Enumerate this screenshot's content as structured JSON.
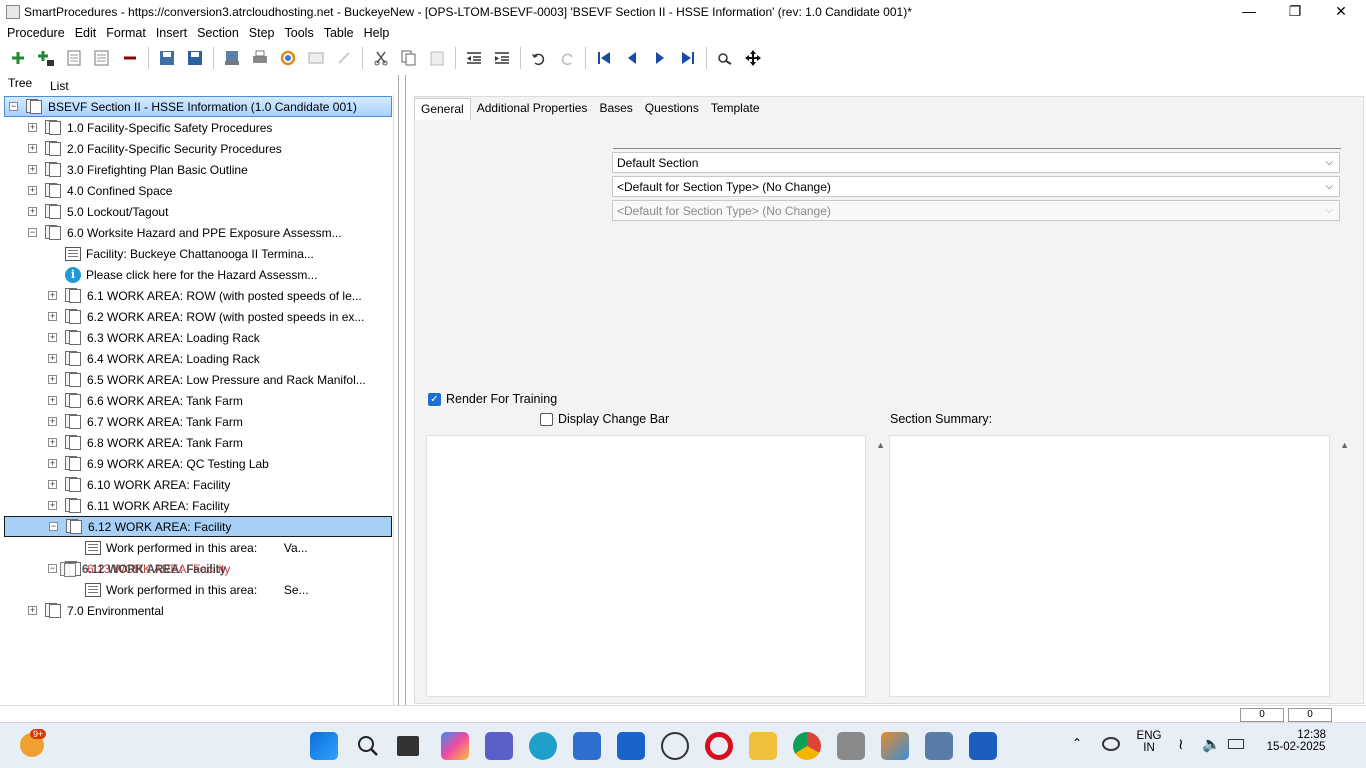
{
  "window": {
    "title": "SmartProcedures - https://conversion3.atrcloudhosting.net - BuckeyeNew - [OPS-LTOM-BSEVF-0003] 'BSEVF Section II - HSSE Information' (rev: 1.0 Candidate 001)*"
  },
  "menu": [
    "Procedure",
    "Edit",
    "Format",
    "Insert",
    "Section",
    "Step",
    "Tools",
    "Table",
    "Help"
  ],
  "toolbar_icons": [
    "add-icon",
    "add-child-icon",
    "section-icon",
    "section2-icon",
    "remove-icon",
    "save-copy-icon",
    "save-icon",
    "publish-icon",
    "print-icon",
    "refresh-icon",
    "pdf-icon",
    "disabled-icon",
    "cut-icon",
    "copy-icon",
    "paste-icon",
    "outdent-icon",
    "indent-icon",
    "undo-icon",
    "redo-icon",
    "first-icon",
    "prev-icon",
    "next-icon",
    "last-icon",
    "search-icon",
    "move-icon"
  ],
  "left_tabs": {
    "tree": "Tree",
    "list": "List"
  },
  "tree": [
    {
      "label": "BSEVF Section II - HSSE Information (1.0 Candidate 001)",
      "level": 0,
      "exp": "−",
      "icon": "section",
      "selected": true
    },
    {
      "label": "1.0 Facility-Specific Safety Procedures",
      "level": 1,
      "exp": "+",
      "icon": "section"
    },
    {
      "label": "2.0 Facility-Specific Security Procedures",
      "level": 1,
      "exp": "+",
      "icon": "section"
    },
    {
      "label": "3.0 Firefighting Plan Basic Outline",
      "level": 1,
      "exp": "+",
      "icon": "section"
    },
    {
      "label": "4.0 Confined Space",
      "level": 1,
      "exp": "+",
      "icon": "section"
    },
    {
      "label": "5.0 Lockout/Tagout",
      "level": 1,
      "exp": "+",
      "icon": "section"
    },
    {
      "label": "6.0 Worksite Hazard and PPE Exposure Assessm...",
      "level": 1,
      "exp": "−",
      "icon": "section"
    },
    {
      "label": "Facility: Buckeye Chattanooga II Termina...",
      "level": 2,
      "exp": "",
      "icon": "step"
    },
    {
      "label": "Please click here for the Hazard Assessm...",
      "level": 2,
      "exp": "",
      "icon": "info"
    },
    {
      "label": "6.1 WORK AREA: ROW (with posted speeds of le...",
      "level": 2,
      "exp": "+",
      "icon": "section"
    },
    {
      "label": "6.2 WORK AREA: ROW (with posted speeds in ex...",
      "level": 2,
      "exp": "+",
      "icon": "section"
    },
    {
      "label": "6.3 WORK AREA: Loading Rack",
      "level": 2,
      "exp": "+",
      "icon": "section"
    },
    {
      "label": "6.4 WORK AREA: Loading Rack",
      "level": 2,
      "exp": "+",
      "icon": "section"
    },
    {
      "label": "6.5 WORK AREA: Low Pressure and Rack Manifol...",
      "level": 2,
      "exp": "+",
      "icon": "section"
    },
    {
      "label": "6.6 WORK AREA: Tank Farm",
      "level": 2,
      "exp": "+",
      "icon": "section"
    },
    {
      "label": "6.7 WORK AREA: Tank Farm",
      "level": 2,
      "exp": "+",
      "icon": "section"
    },
    {
      "label": "6.8 WORK AREA: Tank Farm",
      "level": 2,
      "exp": "+",
      "icon": "section"
    },
    {
      "label": "6.9 WORK AREA: QC Testing Lab",
      "level": 2,
      "exp": "+",
      "icon": "section"
    },
    {
      "label": "6.10 WORK AREA: Facility",
      "level": 2,
      "exp": "+",
      "icon": "section"
    },
    {
      "label": "6.11 WORK AREA: Facility",
      "level": 2,
      "exp": "+",
      "icon": "section"
    },
    {
      "label": "6.12 WORK AREA: Facility",
      "level": 2,
      "exp": "−",
      "icon": "section",
      "selected2": true
    },
    {
      "label": "Work performed in this area:        Va...",
      "level": 3,
      "exp": "",
      "icon": "step"
    },
    {
      "label": "6.13 WORK AREA: Facility",
      "level": 2,
      "exp": "−",
      "icon": "section",
      "red": true
    },
    {
      "label": "Work performed in this area:        Se...",
      "level": 3,
      "exp": "",
      "icon": "step"
    },
    {
      "label": "7.0 Environmental",
      "level": 1,
      "exp": "+",
      "icon": "section"
    }
  ],
  "drag_ghost": "6.12 WORK AREA: Facility",
  "tabs": [
    "General",
    "Additional Properties",
    "Bases",
    "Questions",
    "Template"
  ],
  "fields": {
    "section_type": "Default Section",
    "dropdown2": "<Default for Section Type> (No Change)",
    "dropdown3": "<Default for Section Type> (No Change)"
  },
  "checkboxes": {
    "render_for_training": {
      "label": "Render For Training",
      "checked": true
    },
    "display_change_bar": {
      "label": "Display Change Bar",
      "checked": false
    }
  },
  "section_summary_label": "Section Summary:",
  "status": {
    "box1": "0",
    "box2": "0"
  },
  "taskbar": {
    "badge": "9+",
    "lang": "ENG",
    "region": "IN",
    "time": "12:38",
    "date": "15-02-2025",
    "icons": [
      "start-icon",
      "search-icon",
      "taskview-icon",
      "copilot-icon",
      "teams-icon",
      "edge-icon",
      "store-icon",
      "mail-icon",
      "dell-icon",
      "opera-icon",
      "explorer-icon",
      "chrome-icon",
      "app1-icon",
      "smartprocedures-icon",
      "app2-icon",
      "word-icon"
    ]
  }
}
